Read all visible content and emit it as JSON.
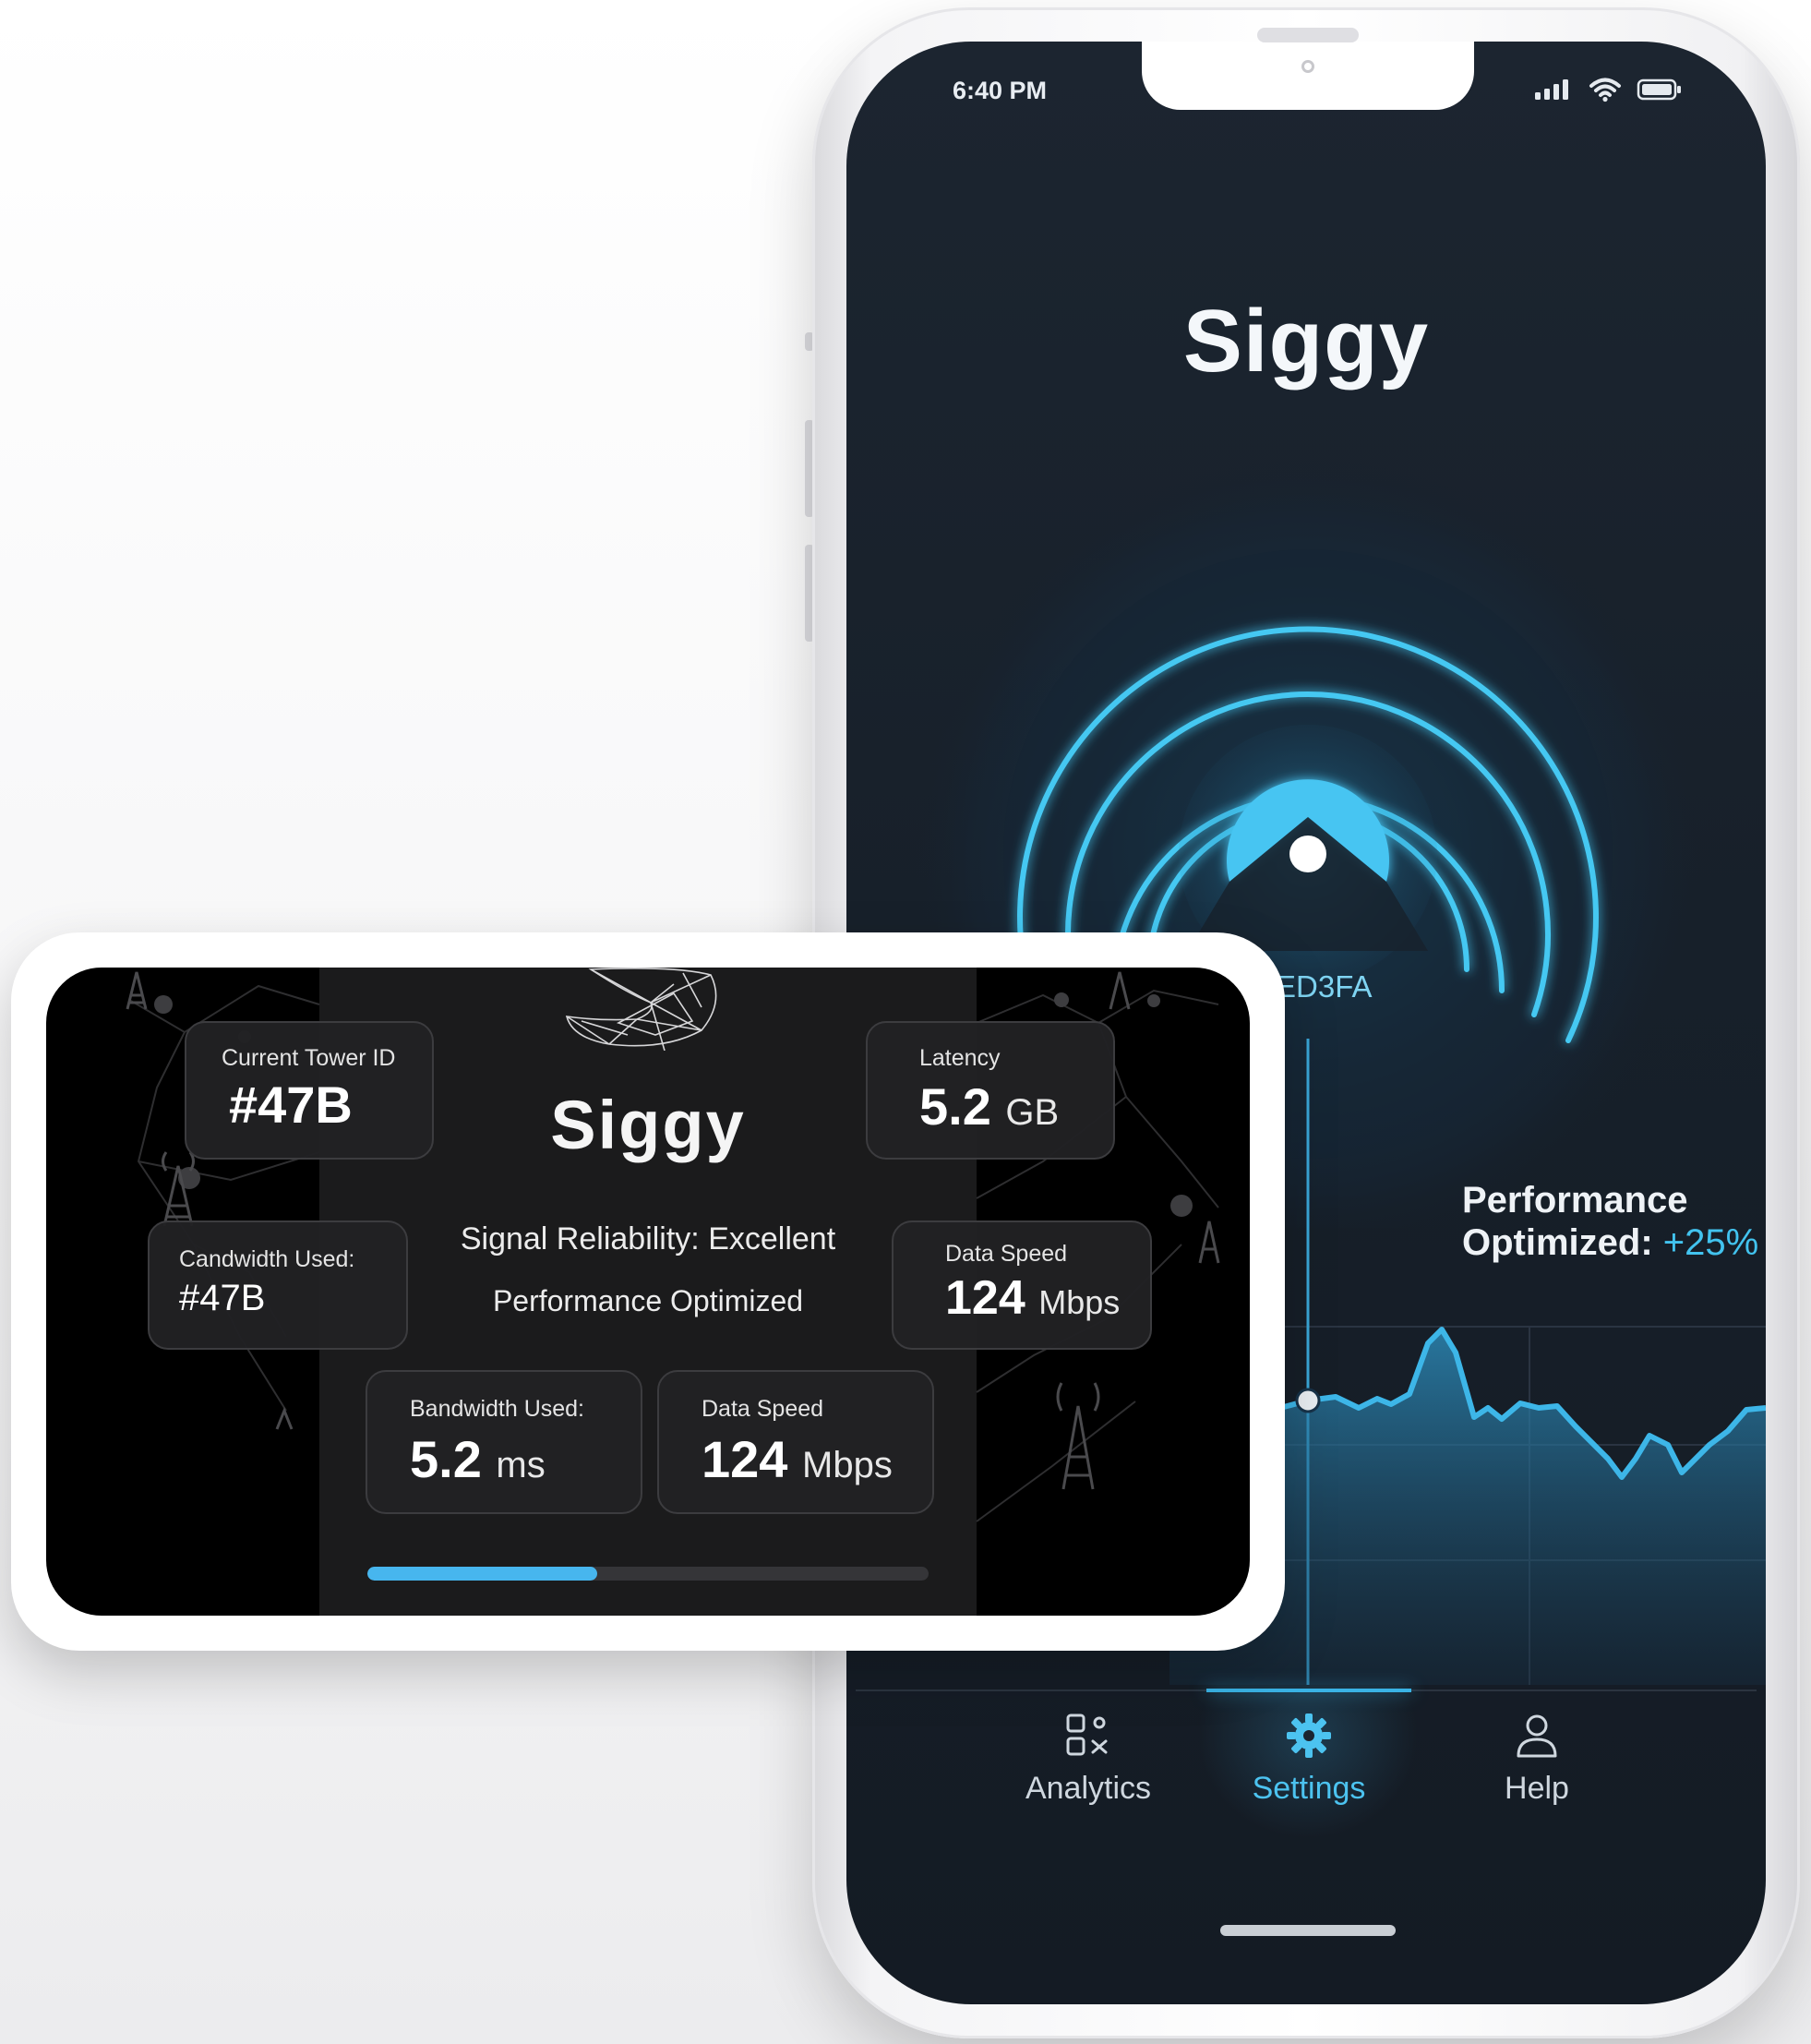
{
  "phone": {
    "status_time": "6:40 PM",
    "app_title": "Siggy",
    "tower_code": "ED3FA",
    "performance": {
      "line1": "Performance",
      "line2": "Optimized:",
      "value": "+25%"
    },
    "nav": {
      "items": [
        {
          "label": "Analytics",
          "icon": "analytics-grid-icon",
          "active": false
        },
        {
          "label": "Settings",
          "icon": "gear-icon",
          "active": true
        },
        {
          "label": "Help",
          "icon": "user-icon",
          "active": false
        }
      ]
    },
    "colors": {
      "accent": "#3ab3e5",
      "screen_bg": "#17202a"
    }
  },
  "card": {
    "title": "Siggy",
    "reliability": "Signal Reliability: Excellent",
    "performance": "Performance Optimized",
    "stats": {
      "tower": {
        "label": "Current Tower ID",
        "value": "#47B"
      },
      "latency": {
        "label": "Latency",
        "value": "5.2",
        "unit": "GB"
      },
      "candwidth": {
        "label": "Candwidth Used:",
        "value": "#47B"
      },
      "speed_top": {
        "label": "Data Speed",
        "value": "124",
        "unit": "Mbps"
      },
      "bandwidth": {
        "label": "Bandwidth Used:",
        "value": "5.2",
        "unit": "ms"
      },
      "speed_bottom": {
        "label": "Data Speed",
        "value": "124",
        "unit": "Mbps"
      }
    },
    "progress_fraction": 0.41,
    "colors": {
      "progress": "#47b6ee"
    }
  }
}
